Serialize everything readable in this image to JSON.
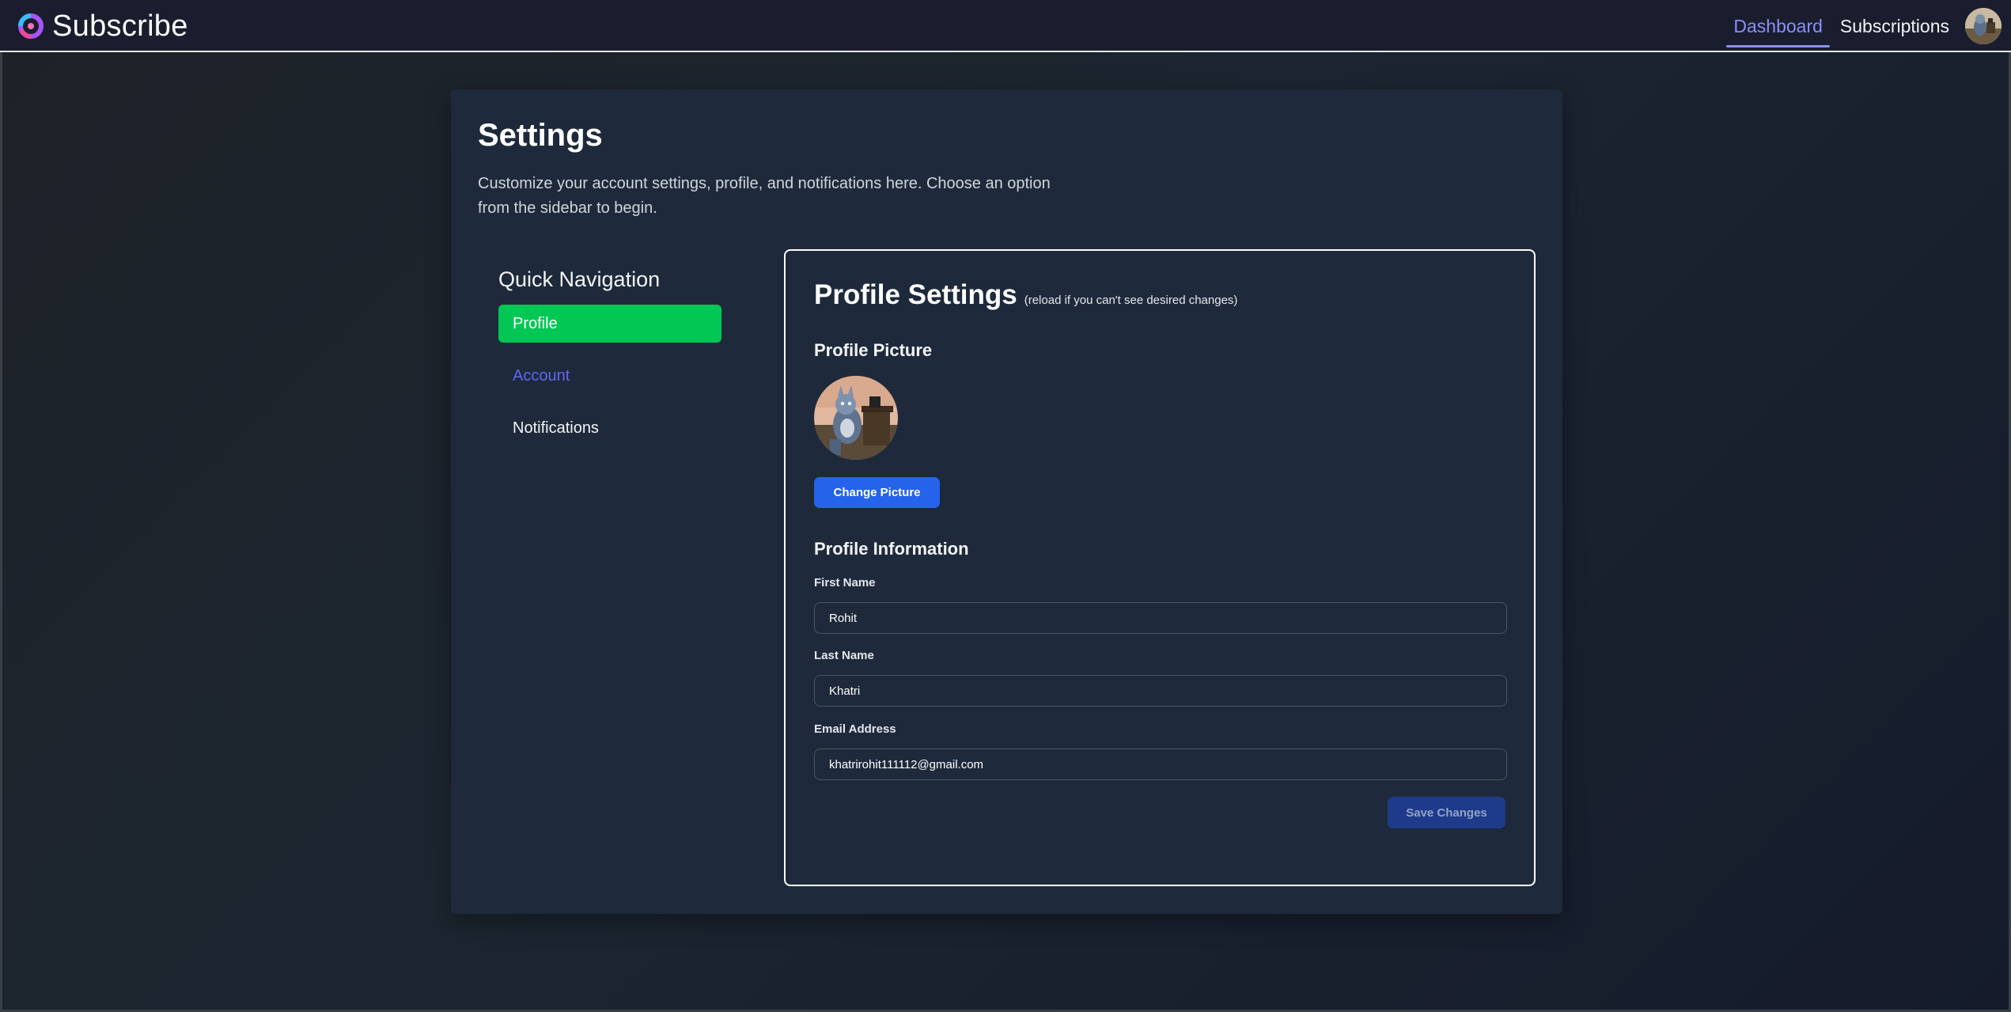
{
  "navbar": {
    "brand_name": "Subscribe",
    "links": {
      "dashboard": "Dashboard",
      "subscriptions": "Subscriptions"
    }
  },
  "page": {
    "title": "Settings",
    "description": "Customize your account settings, profile, and notifications here. Choose an option from the sidebar to begin."
  },
  "sidebar": {
    "heading": "Quick Navigation",
    "items": [
      {
        "label": "Profile",
        "state": "active"
      },
      {
        "label": "Account",
        "state": "accent"
      },
      {
        "label": "Notifications",
        "state": "default"
      }
    ]
  },
  "profile": {
    "title": "Profile Settings",
    "note": "(reload if you can't see desired changes)",
    "picture_heading": "Profile Picture",
    "change_picture_label": "Change Picture",
    "info_heading": "Profile Information",
    "fields": {
      "first_name": {
        "label": "First Name",
        "value": "Rohit"
      },
      "last_name": {
        "label": "Last Name",
        "value": "Khatri"
      },
      "email": {
        "label": "Email Address",
        "value": "khatrirohit111112@gmail.com"
      }
    },
    "save_label": "Save Changes"
  },
  "colors": {
    "accent": "#8b8ff7",
    "active_nav": "#02c754",
    "primary_button": "#2563eb",
    "disabled_button": "#1e3a8a"
  },
  "icons": {
    "brand": "subscribe-logo-icon",
    "avatar": "user-avatar-image"
  }
}
